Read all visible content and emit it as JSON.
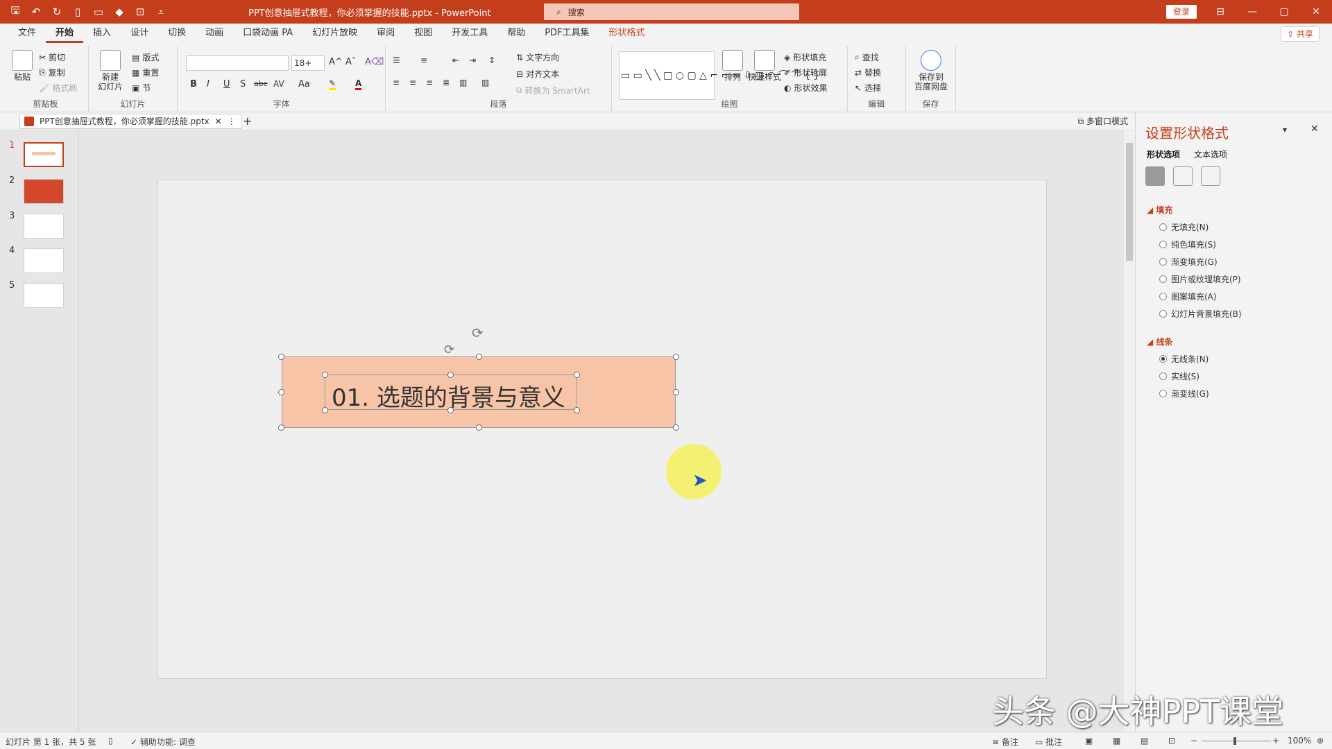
{
  "titlebar": {
    "title": "PPT创意抽屉式教程，你必须掌握的技能.pptx  -  PowerPoint",
    "search_placeholder": "搜索",
    "login": "登录",
    "accent_color": "#c43e1c"
  },
  "tabs": [
    "文件",
    "开始",
    "插入",
    "设计",
    "切换",
    "动画",
    "口袋动画 PA",
    "幻灯片放映",
    "审阅",
    "视图",
    "开发工具",
    "帮助",
    "PDF工具集",
    "形状格式"
  ],
  "share": "共享",
  "ribbon": {
    "clipboard": {
      "label": "剪贴板",
      "paste": "粘贴",
      "cut": "剪切",
      "copy": "复制",
      "format_painter": "格式刷"
    },
    "slides": {
      "label": "幻灯片",
      "new_slide": "新建\n幻灯片",
      "layout": "版式",
      "reset": "重置",
      "section": "节"
    },
    "font": {
      "label": "字体",
      "font_size": "18+",
      "bold": "B",
      "italic": "I",
      "underline": "U",
      "shadow": "S",
      "strike": "abc",
      "case": "Aa"
    },
    "paragraph": {
      "label": "段落",
      "text_direction": "文字方向",
      "align_text": "对齐文本",
      "smartart": "转换为 SmartArt"
    },
    "drawing": {
      "label": "绘图",
      "arrange": "排列",
      "quick_styles": "快速样式",
      "shape_fill": "形状填充",
      "shape_outline": "形状轮廓",
      "shape_effects": "形状效果"
    },
    "editing": {
      "label": "编辑",
      "find": "查找",
      "replace": "替换",
      "select": "选择"
    },
    "save": {
      "label": "保存",
      "save_to": "保存到\n百度网盘"
    }
  },
  "document_tab": "PPT创意抽屉式教程，你必须掌握的技能.pptx",
  "multi_window": "多窗口模式",
  "slide_numbers": [
    "1",
    "2",
    "3",
    "4",
    "5"
  ],
  "slide": {
    "text": "01.    选题的背景与意义",
    "shape_fill": "#f8c4a8"
  },
  "format_pane": {
    "title": "设置形状格式",
    "tab_shape": "形状选项",
    "tab_text": "文本选项",
    "fill_section": "填充",
    "fill_options": [
      "无填充(N)",
      "纯色填充(S)",
      "渐变填充(G)",
      "图片或纹理填充(P)",
      "图案填充(A)",
      "幻灯片背景填充(B)"
    ],
    "line_section": "线条",
    "line_options": [
      "无线条(N)",
      "实线(S)",
      "渐变线(G)"
    ],
    "line_selected": "无线条(N)"
  },
  "status": {
    "slide_info": "幻灯片 第 1 张，共 5 张",
    "accessibility": "辅助功能: 调查",
    "notes": "备注",
    "comments": "批注",
    "zoom": "100%"
  },
  "watermark": "头条 @大神PPT课堂"
}
